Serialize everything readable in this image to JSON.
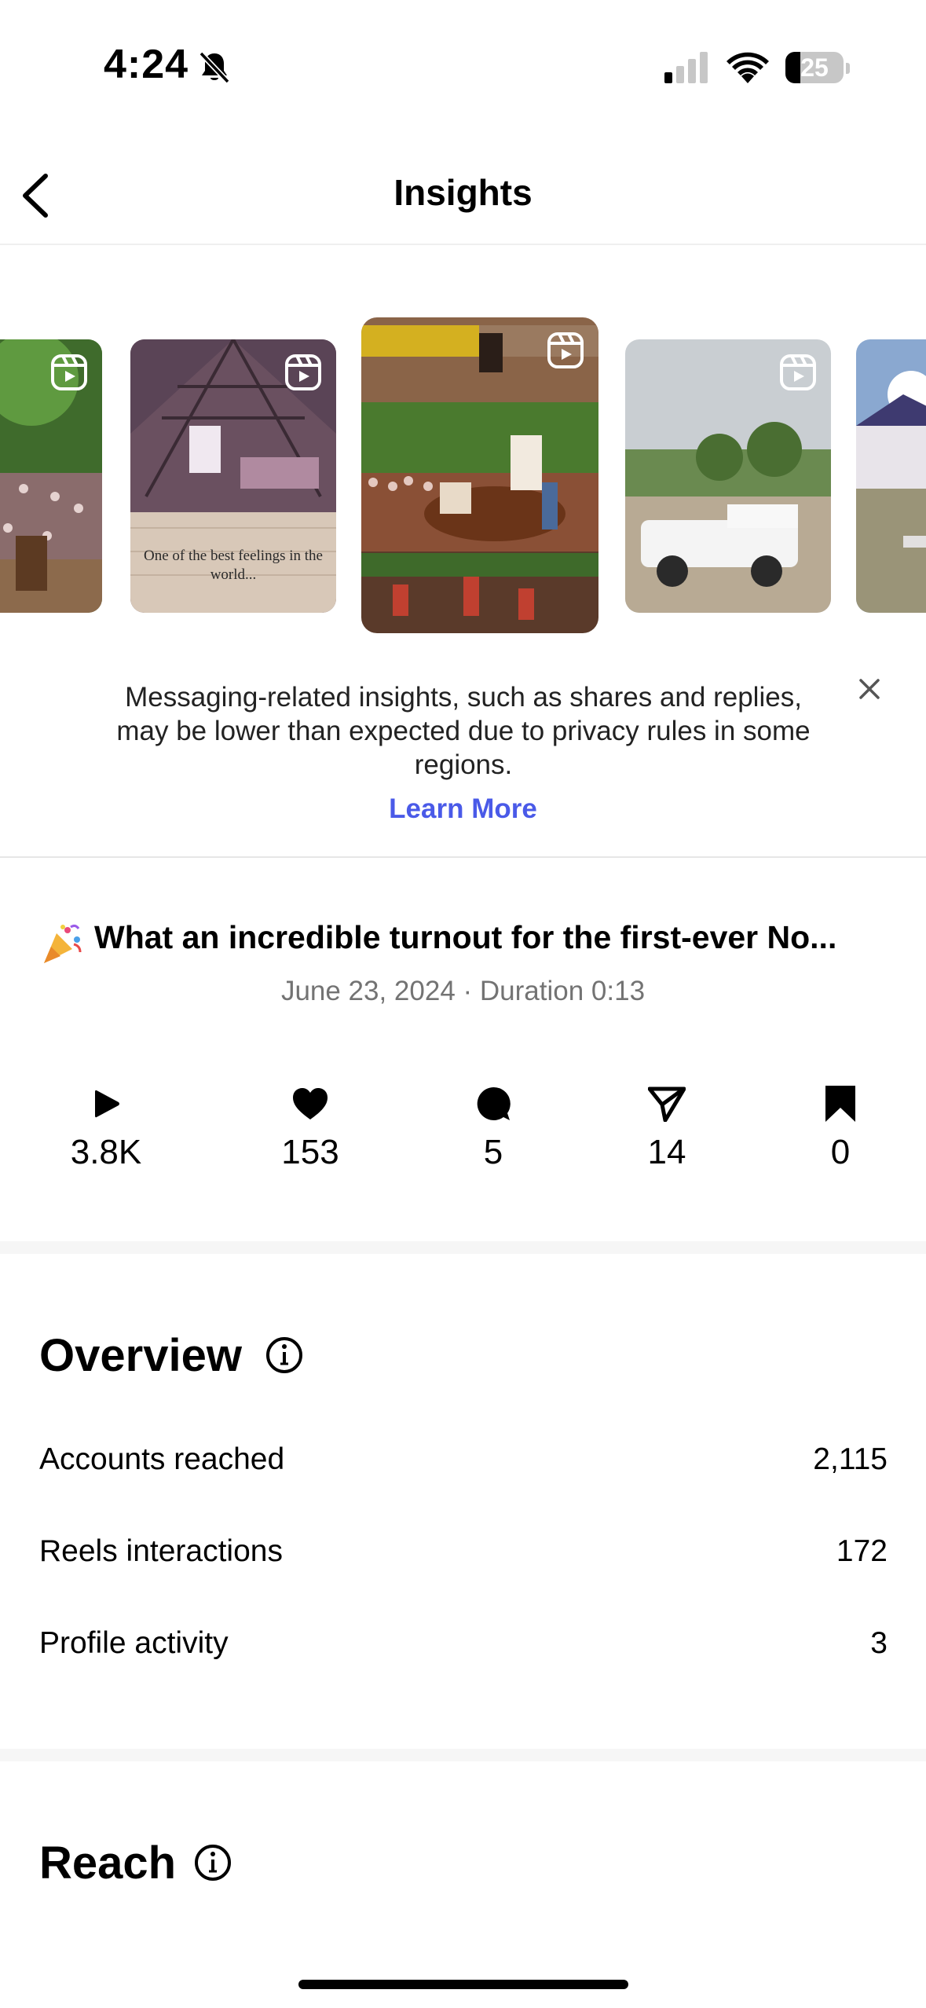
{
  "status_bar": {
    "time": "4:24",
    "battery_level": 25,
    "battery_text": "25",
    "signal_bars_active": 1,
    "icons": [
      "bell-slash-icon",
      "signal-icon",
      "wifi-icon",
      "battery-icon"
    ]
  },
  "nav": {
    "title": "Insights",
    "back_icon": "chevron-left-icon"
  },
  "carousel": {
    "items": [
      {
        "kind": "reel",
        "scene": "rodeo crowd",
        "caption": "",
        "selected": false
      },
      {
        "kind": "reel",
        "scene": "barn interior",
        "caption": "One of the best feelings in the world...",
        "selected": false
      },
      {
        "kind": "reel",
        "scene": "rodeo collage",
        "caption": "",
        "selected": true
      },
      {
        "kind": "reel",
        "scene": "white truck",
        "caption": "",
        "selected": false
      },
      {
        "kind": "reel",
        "scene": "barn exterior",
        "caption": "",
        "selected": false
      }
    ]
  },
  "notice": {
    "text": "Messaging-related insights, such as shares and replies, may be lower than expected due to privacy rules in some regions.",
    "link": "Learn More",
    "link_color": "#4a5ae8"
  },
  "post": {
    "emoji": "🎉",
    "title": "What an incredible turnout for the first-ever No...",
    "meta": "June 23, 2024 · Duration 0:13"
  },
  "stats": [
    {
      "icon": "play-icon",
      "value": "3.8K"
    },
    {
      "icon": "heart-icon",
      "value": "153"
    },
    {
      "icon": "comment-icon",
      "value": "5"
    },
    {
      "icon": "share-icon",
      "value": "14"
    },
    {
      "icon": "bookmark-icon",
      "value": "0"
    }
  ],
  "overview": {
    "title": "Overview",
    "rows": [
      {
        "label": "Accounts reached",
        "value": "2,115"
      },
      {
        "label": "Reels interactions",
        "value": "172"
      },
      {
        "label": "Profile activity",
        "value": "3"
      }
    ]
  },
  "reach": {
    "title": "Reach"
  }
}
